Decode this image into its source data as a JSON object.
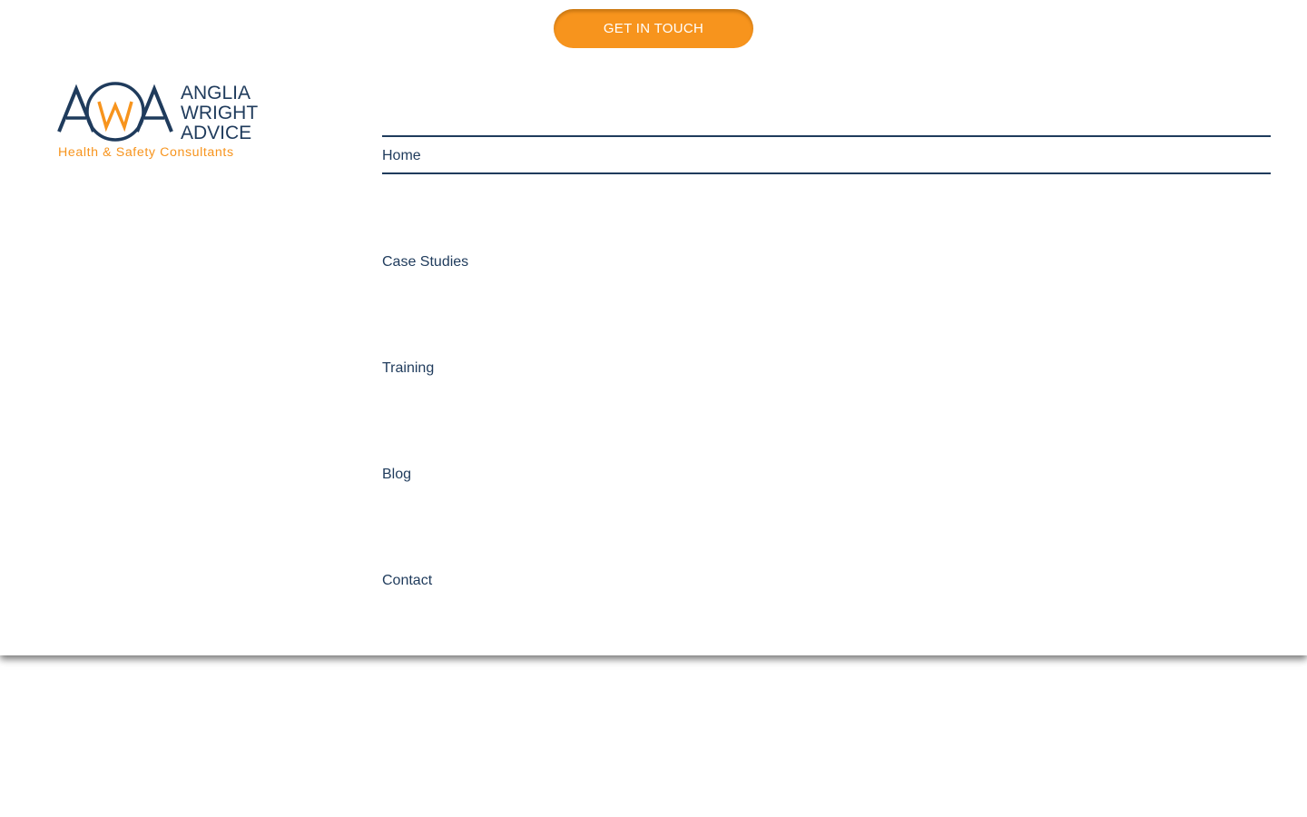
{
  "cta": {
    "label": "GET IN TOUCH"
  },
  "logo": {
    "line1": "ANGLIA",
    "line2": "WRIGHT",
    "line3": "ADVICE",
    "tagline": "Health & Safety Consultants",
    "mark_letters": [
      "A",
      "W",
      "A"
    ]
  },
  "nav": {
    "items": [
      {
        "label": "Home",
        "active": true
      },
      {
        "label": "Case Studies",
        "active": false
      },
      {
        "label": "Training",
        "active": false
      },
      {
        "label": "Blog",
        "active": false
      },
      {
        "label": "Contact",
        "active": false
      }
    ]
  },
  "colors": {
    "navy": "#1f3b5c",
    "orange": "#f7941d",
    "background": "#ffffff"
  }
}
